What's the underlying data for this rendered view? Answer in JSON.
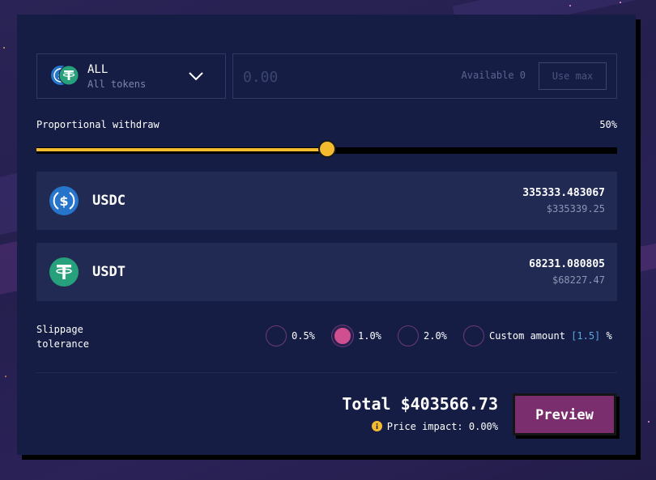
{
  "token_select": {
    "label": "ALL",
    "sublabel": "All tokens",
    "icons": [
      "usdc-icon",
      "usdt-icon"
    ]
  },
  "amount": {
    "placeholder": "0.00",
    "available": "Available 0",
    "use_max_label": "Use max"
  },
  "withdraw": {
    "label": "Proportional withdraw",
    "percent_label": "50%",
    "percent": 50
  },
  "tokens": [
    {
      "symbol": "USDC",
      "amount": "335333.483067",
      "usd": "$335339.25",
      "icon": "usdc-icon",
      "color": "#2775ca"
    },
    {
      "symbol": "USDT",
      "amount": "68231.080805",
      "usd": "$68227.47",
      "icon": "usdt-icon",
      "color": "#26a17b"
    }
  ],
  "slippage": {
    "label_line1": "Slippage",
    "label_line2": "tolerance",
    "options": [
      {
        "label": "0.5%",
        "selected": false
      },
      {
        "label": "1.0%",
        "selected": true
      },
      {
        "label": "2.0%",
        "selected": false
      }
    ],
    "custom_label": "Custom amount",
    "custom_value": "[1.5]",
    "custom_unit": "%"
  },
  "summary": {
    "total": "Total $403566.73",
    "price_impact": "Price impact: 0.00%"
  },
  "actions": {
    "preview_label": "Preview"
  },
  "colors": {
    "accent_yellow": "#f5bb2f",
    "accent_pink": "#d04f90",
    "button_purple": "#7a2e6e",
    "panel_bg": "#151d45"
  }
}
